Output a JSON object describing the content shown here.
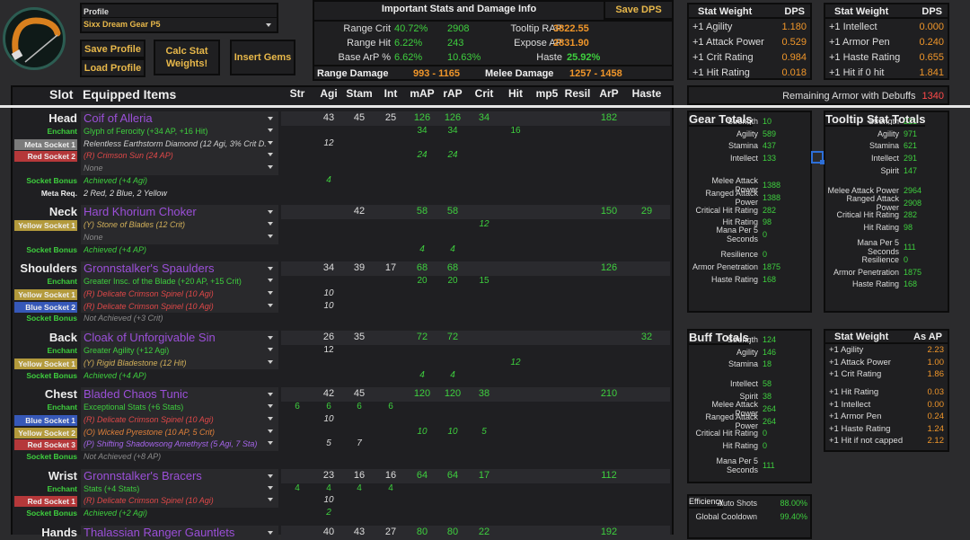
{
  "logo": {
    "icon": "bow-icon"
  },
  "profile": {
    "label": "Profile",
    "value": "Sixx Dream Gear P5"
  },
  "buttons": {
    "save_profile": "Save Profile",
    "load_profile": "Load Profile",
    "calc": "Calc Stat Weights!",
    "insert_gems": "Insert Gems",
    "save_dps": "Save DPS"
  },
  "important": {
    "title": "Important Stats and Damage Info",
    "cols": [
      [
        {
          "label": "Range Crit",
          "value": "40.72%"
        },
        {
          "label": "Range Hit",
          "value": "6.22%"
        },
        {
          "label": "Base ArP %",
          "value": "6.62%"
        }
      ],
      [
        {
          "label": "Tooltip RAP",
          "value": "2908"
        },
        {
          "label": "Expose AP",
          "value": "243"
        },
        {
          "label": "Haste",
          "value": "10.63%"
        }
      ],
      [
        {
          "label": "Active DPS",
          "value": "3822.55"
        },
        {
          "label": "Saved DPS",
          "value": "2831.90"
        },
        {
          "label": "Δ %",
          "value": "25.92%"
        }
      ]
    ],
    "range_damage_label": "Range Damage",
    "range_damage": "993 - 1165",
    "melee_damage_label": "Melee Damage",
    "melee_damage": "1257 - 1458"
  },
  "stat_weight_dps": [
    {
      "header": [
        "Stat Weight",
        "DPS"
      ],
      "rows": [
        {
          "label": "+1 Agility",
          "value": "1.180"
        },
        {
          "label": "+1 Attack Power",
          "value": "0.529"
        },
        {
          "label": "+1 Crit Rating",
          "value": "0.984"
        },
        {
          "label": "+1 Hit Rating",
          "value": "0.018"
        }
      ]
    },
    {
      "header": [
        "Stat Weight",
        "DPS"
      ],
      "rows": [
        {
          "label": "+1 Intellect",
          "value": "0.000"
        },
        {
          "label": "+1 Armor Pen",
          "value": "0.240"
        },
        {
          "label": "+1 Haste Rating",
          "value": "0.655"
        },
        {
          "label": "+1 Hit if 0 hit",
          "value": "1.841"
        }
      ]
    }
  ],
  "remaining_armor": {
    "label": "Remaining Armor with Debuffs",
    "value": "1340"
  },
  "table": {
    "slot_header": "Slot",
    "items_header": "Equipped Items",
    "stat_headers": {
      "str": "Str",
      "agi": "Agi",
      "stam": "Stam",
      "int": "Int",
      "map": "mAP",
      "rap": "rAP",
      "crit": "Crit",
      "hit": "Hit",
      "mp5": "mp5",
      "resil": "Resil",
      "arp": "ArP",
      "haste": "Haste"
    },
    "groups": [
      {
        "slot": "Head",
        "item": "Coif of Alleria",
        "stats": {
          "agi": "43",
          "stam": "45",
          "int": "25",
          "map": "126",
          "rap": "126",
          "crit": "34",
          "arp": "182"
        },
        "rows": [
          {
            "type": "enchant",
            "label": "Enchant",
            "value": "Glyph of Ferocity (+34 AP, +16 Hit)",
            "stats": {
              "map": "34",
              "rap": "34",
              "hit": "16"
            }
          },
          {
            "type": "gem",
            "socket": "meta",
            "label": "Meta Socket 1",
            "value": "Relentless Earthstorm Diamond (12 Agi, 3% Crit D.",
            "stats": {
              "agi": "12"
            }
          },
          {
            "type": "gem",
            "socket": "red",
            "gem": "red",
            "label": "Red Socket 2",
            "value": "(R) Crimson Sun (24 AP)",
            "stats": {
              "map": "24",
              "rap": "24"
            }
          },
          {
            "type": "gem",
            "gem": "none",
            "label": "",
            "value": "None",
            "stats": {}
          },
          {
            "type": "bonus",
            "achieved": true,
            "label": "Socket Bonus",
            "value": "Achieved (+4 Agi)",
            "stats": {
              "agi": "4"
            }
          },
          {
            "type": "metareq",
            "label": "Meta Req.",
            "value": "2 Red, 2 Blue, 2 Yellow",
            "stats": {}
          }
        ]
      },
      {
        "slot": "Neck",
        "item": "Hard Khorium Choker",
        "stats": {
          "stam": "42",
          "map": "58",
          "rap": "58",
          "arp": "150",
          "haste": "29"
        },
        "rows": [
          {
            "type": "gem",
            "socket": "yellow",
            "gem": "yellow",
            "label": "Yellow Socket 1",
            "value": "(Y) Stone of Blades (12 Crit)",
            "stats": {
              "crit": "12"
            }
          },
          {
            "type": "gem",
            "gem": "none",
            "label": "",
            "value": "None",
            "stats": {}
          },
          {
            "type": "bonus",
            "achieved": true,
            "label": "Socket Bonus",
            "value": "Achieved (+4 AP)",
            "stats": {
              "map": "4",
              "rap": "4"
            }
          }
        ]
      },
      {
        "slot": "Shoulders",
        "item": "Gronnstalker's Spaulders",
        "stats": {
          "agi": "34",
          "stam": "39",
          "int": "17",
          "map": "68",
          "rap": "68",
          "arp": "126"
        },
        "rows": [
          {
            "type": "enchant",
            "label": "Enchant",
            "value": "Greater Insc. of the Blade (+20 AP, +15 Crit)",
            "stats": {
              "map": "20",
              "rap": "20",
              "crit": "15"
            }
          },
          {
            "type": "gem",
            "socket": "yellow",
            "gem": "red",
            "label": "Yellow Socket 1",
            "value": "(R) Delicate Crimson Spinel (10 Agi)",
            "stats": {
              "agi": "10"
            }
          },
          {
            "type": "gem",
            "socket": "blue",
            "gem": "red",
            "label": "Blue Socket 2",
            "value": "(R) Delicate Crimson Spinel (10 Agi)",
            "stats": {
              "agi": "10"
            }
          },
          {
            "type": "bonus",
            "achieved": false,
            "label": "Socket Bonus",
            "value": "Not Achieved (+3 Crit)",
            "stats": {}
          }
        ]
      },
      {
        "slot": "Back",
        "item": "Cloak of Unforgivable Sin",
        "stats": {
          "agi": "26",
          "stam": "35",
          "map": "72",
          "rap": "72",
          "haste": "32"
        },
        "rows": [
          {
            "type": "enchant",
            "primary_color": "#dddddd",
            "label": "Enchant",
            "value": "Greater Agility (+12 Agi)",
            "stats": {
              "agi": "12"
            }
          },
          {
            "type": "gem",
            "socket": "yellow",
            "gem": "yellow",
            "label": "Yellow Socket 1",
            "value": "(Y) Rigid Bladestone (12 Hit)",
            "stats": {
              "hit": "12"
            }
          },
          {
            "type": "bonus",
            "achieved": true,
            "label": "Socket Bonus",
            "value": "Achieved (+4 AP)",
            "stats": {
              "map": "4",
              "rap": "4"
            }
          }
        ]
      },
      {
        "slot": "Chest",
        "item": "Bladed Chaos Tunic",
        "stats": {
          "agi": "42",
          "stam": "45",
          "map": "120",
          "rap": "120",
          "crit": "38",
          "arp": "210"
        },
        "rows": [
          {
            "type": "enchant",
            "label": "Enchant",
            "value": "Exceptional Stats (+6 Stats)",
            "stats": {
              "str": "6",
              "agi": "6",
              "stam": "6",
              "int": "6"
            }
          },
          {
            "type": "gem",
            "socket": "blue",
            "gem": "red",
            "label": "Blue Socket 1",
            "value": "(R) Delicate Crimson Spinel (10 Agi)",
            "stats": {
              "agi": "10"
            }
          },
          {
            "type": "gem",
            "socket": "yellow",
            "gem": "orange",
            "label": "Yellow Socket 2",
            "value": "(O) Wicked Pyrestone (10 AP, 5 Crit)",
            "stats": {
              "map": "10",
              "rap": "10",
              "crit": "5"
            }
          },
          {
            "type": "gem",
            "socket": "red",
            "gem": "purple",
            "label": "Red Socket 3",
            "value": "(P) Shifting Shadowsong Amethyst (5 Agi, 7 Sta)",
            "stats": {
              "agi": "5",
              "stam": "7"
            }
          },
          {
            "type": "bonus",
            "achieved": false,
            "label": "Socket Bonus",
            "value": "Not Achieved (+8 AP)",
            "stats": {}
          }
        ]
      },
      {
        "slot": "Wrist",
        "item": "Gronnstalker's Bracers",
        "stats": {
          "agi": "23",
          "stam": "16",
          "int": "16",
          "map": "64",
          "rap": "64",
          "crit": "17",
          "arp": "112"
        },
        "rows": [
          {
            "type": "enchant",
            "label": "Enchant",
            "value": "Stats (+4 Stats)",
            "stats": {
              "str": "4",
              "agi": "4",
              "stam": "4",
              "int": "4"
            }
          },
          {
            "type": "gem",
            "socket": "red",
            "gem": "red",
            "label": "Red Socket 1",
            "value": "(R) Delicate Crimson Spinel (10 Agi)",
            "stats": {
              "agi": "10"
            }
          },
          {
            "type": "bonus",
            "achieved": true,
            "label": "Socket Bonus",
            "value": "Achieved (+2 Agi)",
            "stats": {
              "agi": "2"
            }
          }
        ]
      },
      {
        "slot": "Hands",
        "item": "Thalassian Ranger Gauntlets",
        "stats": {
          "agi": "40",
          "stam": "43",
          "int": "27",
          "map": "80",
          "rap": "80",
          "crit": "22",
          "arp": "192"
        },
        "rows": []
      }
    ]
  },
  "gear_totals": {
    "title": "Gear Totals",
    "rows": [
      {
        "label": "Strength",
        "value": "10"
      },
      {
        "label": "Agility",
        "value": "589"
      },
      {
        "label": "Stamina",
        "value": "437"
      },
      {
        "label": "Intellect",
        "value": "133"
      },
      null,
      null,
      {
        "label": "Melee Attack Power",
        "value": "1388"
      },
      {
        "label": "Ranged Attack Power",
        "value": "1388"
      },
      {
        "label": "Critical Hit Rating",
        "value": "282"
      },
      {
        "label": "Hit Rating",
        "value": "98"
      },
      {
        "label": "Mana Per 5 Seconds",
        "value": "0"
      },
      null,
      {
        "label": "Resilience",
        "value": "0"
      },
      {
        "label": "Armor Penetration",
        "value": "1875"
      },
      {
        "label": "Haste Rating",
        "value": "168"
      }
    ]
  },
  "tooltip_totals": {
    "title": "Tooltip Stat Totals",
    "rows": [
      {
        "label": "Strength",
        "value": "221"
      },
      {
        "label": "Agility",
        "value": "971"
      },
      {
        "label": "Stamina",
        "value": "621"
      },
      {
        "label": "Intellect",
        "value": "291"
      },
      {
        "label": "Spirit",
        "value": "147"
      },
      null,
      {
        "label": "Melee Attack Power",
        "value": "2964"
      },
      {
        "label": "Ranged Attack Power",
        "value": "2908"
      },
      {
        "label": "Critical Hit Rating",
        "value": "282"
      },
      {
        "label": "Hit Rating",
        "value": "98"
      },
      null,
      {
        "label": "Mana Per 5 Seconds",
        "value": "111"
      },
      {
        "label": "Resilience",
        "value": "0"
      },
      {
        "label": "Armor Penetration",
        "value": "1875"
      },
      {
        "label": "Haste Rating",
        "value": "168"
      }
    ]
  },
  "buff_totals": {
    "title": "Buff Totals",
    "rows": [
      {
        "label": "Strength",
        "value": "124"
      },
      {
        "label": "Agility",
        "value": "146"
      },
      {
        "label": "Stamina",
        "value": "18"
      },
      null,
      {
        "label": "Intellect",
        "value": "58"
      },
      {
        "label": "Spirit",
        "value": "38"
      },
      {
        "label": "Melee Attack Power",
        "value": "264"
      },
      {
        "label": "Ranged Attack Power",
        "value": "264"
      },
      {
        "label": "Critical Hit Rating",
        "value": "0"
      },
      {
        "label": "Hit Rating",
        "value": "0"
      },
      null,
      {
        "label": "Mana Per 5 Seconds",
        "value": "111"
      }
    ]
  },
  "stat_weight_ap": {
    "header": [
      "Stat Weight",
      "As AP"
    ],
    "rows": [
      {
        "label": "+1 Agility",
        "value": "2.23"
      },
      {
        "label": "+1 Attack Power",
        "value": "1.00"
      },
      {
        "label": "+1 Crit Rating",
        "value": "1.86"
      },
      null,
      {
        "label": "+1 Hit Rating",
        "value": "0.03"
      },
      {
        "label": "+1 Intellect",
        "value": "0.00"
      },
      {
        "label": "+1 Armor Pen",
        "value": "0.24"
      },
      {
        "label": "+1 Haste Rating",
        "value": "1.24"
      },
      {
        "label": "+1 Hit if not capped",
        "value": "2.12"
      }
    ]
  },
  "efficiency": {
    "title": "Efficiency",
    "rows": [
      {
        "label": "Auto Shots",
        "value": "88.00%"
      },
      {
        "label": "Global Cooldown",
        "value": "99.40%"
      }
    ]
  },
  "colors": {
    "socket_meta": "#7b7b7b",
    "socket_red": "#b5383a",
    "socket_yellow": "#b39a3c",
    "socket_blue": "#3658b8",
    "gem_red": "#e04848",
    "gem_yellow": "#d2b05a",
    "gem_orange": "#e0803a",
    "gem_purple": "#a565ea",
    "gem_meta": "#d0d0d0",
    "gem_none": "#8a8a8a",
    "green": "#3ecf3e",
    "item": "#9b4fd8",
    "white": "#dddddd"
  }
}
